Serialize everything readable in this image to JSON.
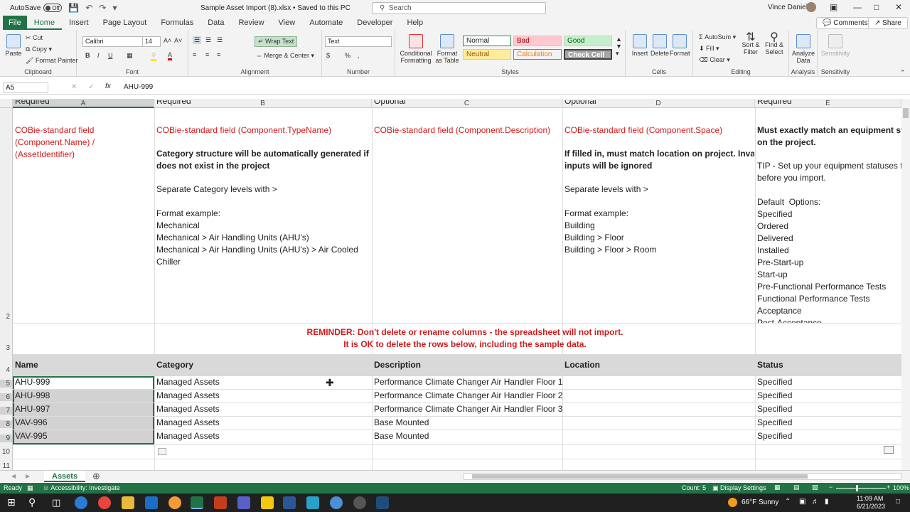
{
  "titlebar": {
    "autosave": "AutoSave",
    "toggle": "Off",
    "doc_title": "Sample Asset Import (8).xlsx • Saved to this PC",
    "search_placeholder": "Search",
    "user": "Vince Daniele"
  },
  "tabs": [
    "File",
    "Home",
    "Insert",
    "Page Layout",
    "Formulas",
    "Data",
    "Review",
    "View",
    "Automate",
    "Developer",
    "Help"
  ],
  "ribbon_buttons": {
    "comments": "Comments",
    "share": "Share"
  },
  "clipboard": {
    "paste": "Paste",
    "cut": "Cut",
    "copy": "Copy",
    "format_painter": "Format Painter",
    "label": "Clipboard"
  },
  "font": {
    "name": "Calibri",
    "size": "14",
    "label": "Font",
    "bold": "B",
    "italic": "I",
    "underline": "U"
  },
  "alignment": {
    "wrap": "Wrap Text",
    "merge": "Merge & Center",
    "label": "Alignment"
  },
  "number": {
    "format": "Text",
    "label": "Number",
    "currency": "$",
    "percent": "%",
    "comma": ","
  },
  "styles": {
    "conditional": "Conditional Formatting",
    "format_table": "Format as Table",
    "normal": "Normal",
    "bad": "Bad",
    "good": "Good",
    "neutral": "Neutral",
    "calculation": "Calculation",
    "check_cell": "Check Cell",
    "label": "Styles"
  },
  "cells": {
    "insert": "Insert",
    "delete": "Delete",
    "format": "Format",
    "label": "Cells"
  },
  "editing": {
    "autosum": "AutoSum",
    "fill": "Fill",
    "clear": "Clear",
    "sort": "Sort & Filter",
    "find": "Find & Select",
    "label": "Editing"
  },
  "analysis": {
    "analyze": "Analyze Data",
    "label": "Analysis"
  },
  "sensitivity": {
    "btn": "Sensitivity",
    "label": "Sensitivity"
  },
  "formula_bar": {
    "name_box": "A5",
    "value": "AHU-999"
  },
  "columns": [
    "A",
    "B",
    "C",
    "D",
    "E"
  ],
  "row_numbers": [
    "2",
    "3",
    "4",
    "5",
    "6",
    "7",
    "8",
    "9",
    "10",
    "11"
  ],
  "row1": {
    "a": "Required",
    "b": "Required",
    "c": "Optional",
    "d": "Optional",
    "e": "Required"
  },
  "row2": {
    "a_red": "COBie-standard field\n(Component.Name) /\n(AssetIdentifier)",
    "b_red": "COBie-standard field (Component.TypeName)",
    "b_bold": "Category structure will be automatically generated if it\ndoes not exist in the project",
    "b_text": "Separate Category levels with >\n\nFormat example:\nMechanical\nMechanical > Air Handling Units (AHU's)\nMechanical > Air Handling Units (AHU's) > Air Cooled\nChiller",
    "c_red": "COBie-standard field (Component.Description)",
    "d_red": "COBie-standard field (Component.Space)",
    "d_bold": "If filled in, must match location on project. Invalid\ninputs will be ignored",
    "d_text": "Separate levels with >\n\nFormat example:\nBuilding\nBuilding > Floor\nBuilding > Floor > Room",
    "e_bold": "Must exactly match an equipment stat\non the project.",
    "e_text": "TIP - Set up your equipment statuses fir\nbefore you import.\n\nDefault  Options:\nSpecified\nOrdered\nDelivered\nInstalled\nPre-Start-up\nStart-up\nPre-Functional Performance Tests\nFunctional Performance Tests\nAcceptance\nPost-Acceptance"
  },
  "reminder": {
    "line1": "REMINDER:  Don't delete or rename columns - the spreadsheet will not import.",
    "line2": "It is OK to delete the rows below, including the sample data."
  },
  "headers": {
    "name": "Name",
    "category": "Category",
    "description": "Description",
    "location": "Location",
    "status": "Status"
  },
  "rows": [
    {
      "name": "AHU-999",
      "category": "Managed Assets",
      "description": "Performance Climate Changer Air Handler Floor 1",
      "location": "",
      "status": "Specified"
    },
    {
      "name": "AHU-998",
      "category": "Managed Assets",
      "description": "Performance Climate Changer Air Handler Floor 2",
      "location": "",
      "status": "Specified"
    },
    {
      "name": "AHU-997",
      "category": "Managed Assets",
      "description": "Performance Climate Changer Air Handler Floor 3",
      "location": "",
      "status": "Specified"
    },
    {
      "name": "VAV-996",
      "category": "Managed Assets",
      "description": "Base Mounted",
      "location": "",
      "status": "Specified"
    },
    {
      "name": "VAV-995",
      "category": "Managed Assets",
      "description": "Base Mounted",
      "location": "",
      "status": "Specified"
    }
  ],
  "sheet_tab": "Assets",
  "status": {
    "ready": "Ready",
    "accessibility": "Accessibility: Investigate",
    "count": "Count: 5",
    "display": "Display Settings",
    "zoom": "100%"
  },
  "taskbar": {
    "weather": "66°F  Sunny",
    "time": "11:09 AM",
    "date": "6/21/2023"
  },
  "colors": {
    "accent": "#217346",
    "red_text": "#d11a1a",
    "header_fill": "#d9d9d9"
  }
}
